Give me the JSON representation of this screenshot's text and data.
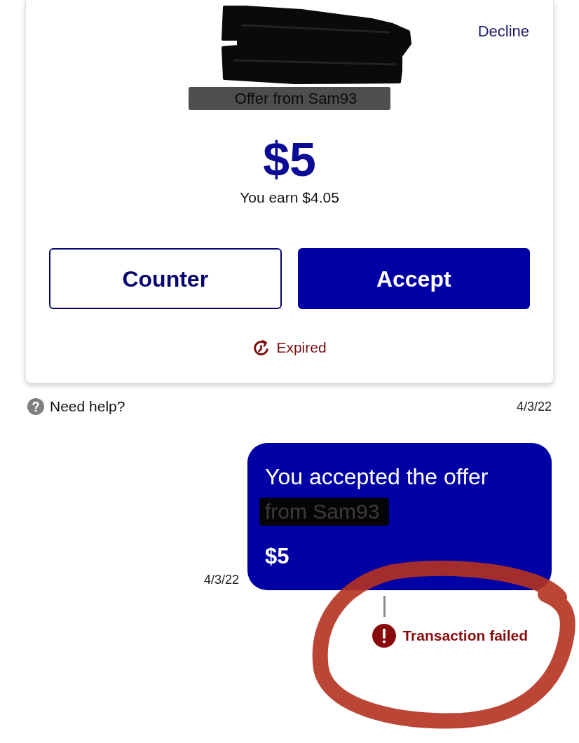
{
  "offer_card": {
    "decline": "Decline",
    "offer_from": {
      "text": "Offer from Sam93",
      "redacted": true
    },
    "price": "$5",
    "earnings": "You earn $4.05",
    "buttons": [
      {
        "label": "Counter",
        "kind": "outline"
      },
      {
        "label": "Accept",
        "kind": "primary"
      }
    ],
    "status": "Expired"
  },
  "help": {
    "label": "Need help?",
    "date": "4/3/22"
  },
  "messages": [
    {
      "lines": [
        {
          "text": "You accepted the offer",
          "redacted": false
        },
        {
          "text": "from Sam93",
          "redacted": true
        }
      ],
      "amount": "$5",
      "date": "4/3/22",
      "status": "Transaction failed"
    }
  ]
}
